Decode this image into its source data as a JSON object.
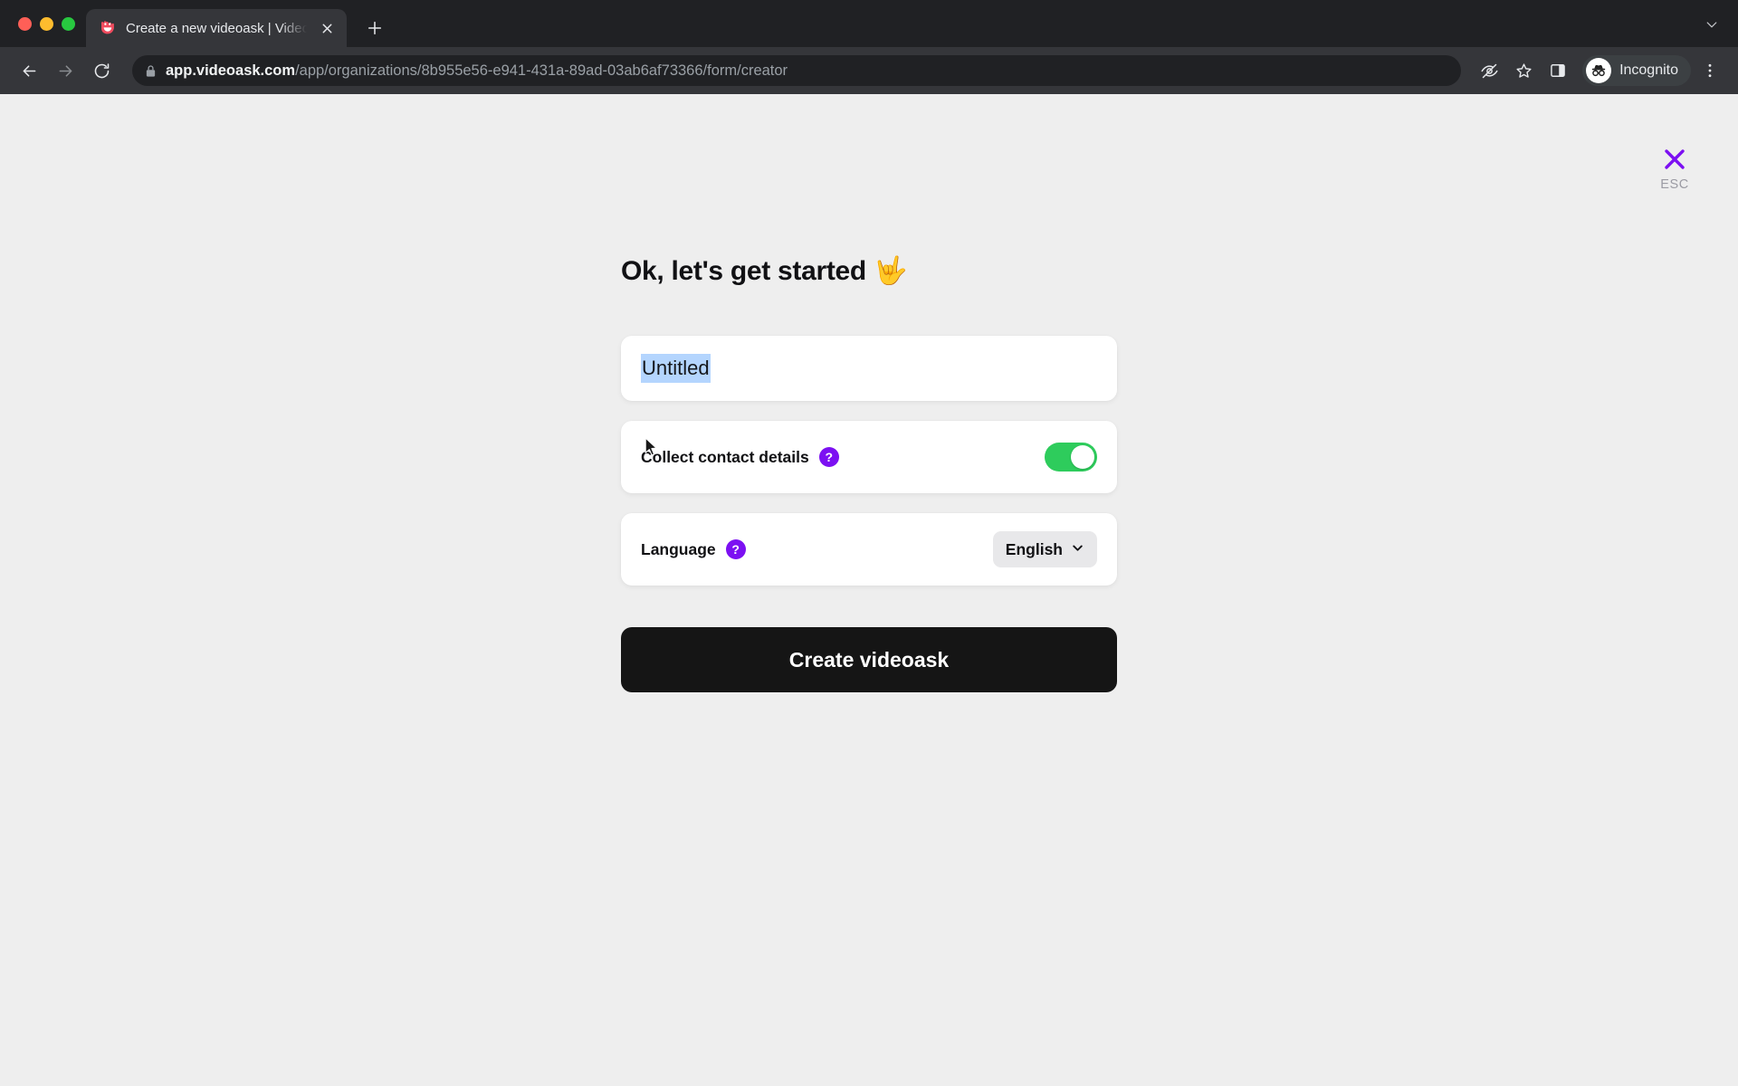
{
  "browser": {
    "traffic_lights": [
      "close",
      "minimize",
      "maximize"
    ],
    "tab": {
      "title": "Create a new videoask | VideoAsk",
      "favicon": "videoask-smiley-icon",
      "close_label": "×"
    },
    "new_tab_label": "+",
    "tabstrip_menu_label": "∨",
    "nav": {
      "back_label": "←",
      "forward_label": "→",
      "reload_label": "↻"
    },
    "omnibox": {
      "lock_icon": "lock-icon",
      "host": "app.videoask.com",
      "path": "/app/organizations/8b955e56-e941-431a-89ad-03ab6af73366/form/creator",
      "full_url": "app.videoask.com/app/organizations/8b955e56-e941-431a-89ad-03ab6af73366/form/creator"
    },
    "toolbar_icons": [
      {
        "name": "eye-slash-icon",
        "title": "Tracking protection"
      },
      {
        "name": "star-icon",
        "title": "Bookmark this tab"
      },
      {
        "name": "side-panel-icon",
        "title": "Side panel"
      }
    ],
    "profile": {
      "label": "Incognito",
      "avatar_icon": "incognito-avatar"
    },
    "menu_label": "⋮"
  },
  "page": {
    "headline": "Ok, let's get started 🤟",
    "esc": {
      "close_icon": "close-x-icon",
      "label": "ESC",
      "color": "#7c10f2"
    },
    "title_field": {
      "value": "Untitled",
      "placeholder": "Untitled",
      "selected": true,
      "selection_color": "#b4d5fe"
    },
    "contact": {
      "label": "Collect contact details",
      "help_label": "?",
      "toggle_on": true,
      "toggle_color": "#2ecc5c"
    },
    "language": {
      "label": "Language",
      "help_label": "?",
      "selected": "English",
      "chevron": "chevron-down-icon"
    },
    "cta_label": "Create videoask",
    "accent_color": "#7c10f2",
    "background_color": "#eeeeee"
  }
}
